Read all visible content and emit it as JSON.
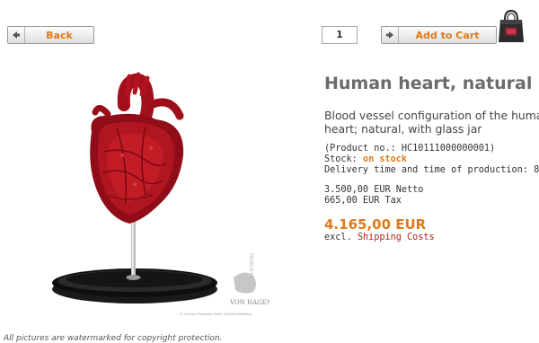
{
  "toolbar": {
    "back_label": "Back",
    "quantity": "1",
    "add_label": "Add to Cart"
  },
  "product": {
    "title": "Human heart, natural",
    "description_line1": "Blood vessel configuration of the huma",
    "description_line2": "heart; natural, with glass jar",
    "product_no": "(Product no.: HC10111000000001)",
    "stock_label": "Stock:",
    "stock_value": "on stock",
    "delivery": "Delivery time and time of production: 8 Wee",
    "net_price": "3.500,00 EUR Netto",
    "tax": "665,00 EUR Tax",
    "gross_price": "4.165,00 EUR",
    "excl_label": "excl.",
    "shipping_link": "Shipping Costs"
  },
  "image": {
    "watermark_brand": "VON HAGENS",
    "watermark_small": "© Gunther Plastinate GmbH, 69126 Heidelberg"
  },
  "footer": {
    "note": "All pictures are watermarked for copyright protection."
  },
  "colors": {
    "accent": "#e07a1a",
    "link": "#b32020",
    "title": "#6b6b6b"
  }
}
